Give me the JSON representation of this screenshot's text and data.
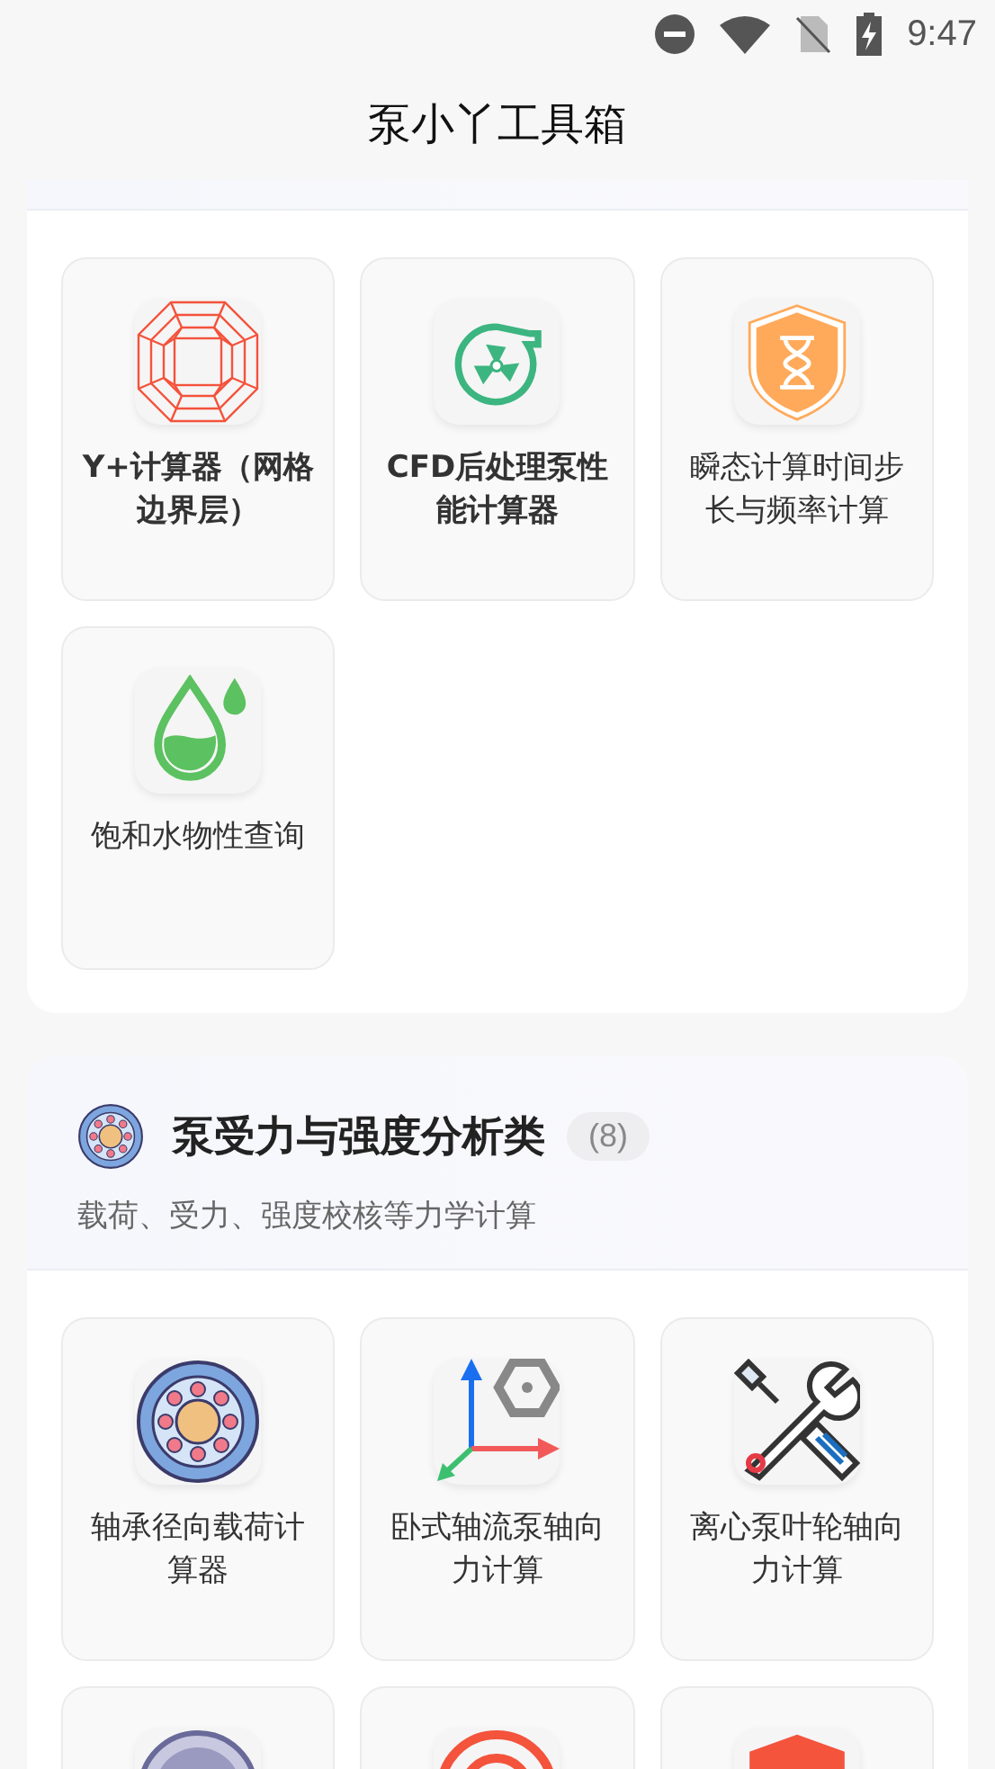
{
  "status_bar": {
    "time": "9:47"
  },
  "app_bar": {
    "title": "泵小丫工具箱"
  },
  "sections": [
    {
      "tools": [
        {
          "kind": "tool",
          "label": "Y+计算器（网格边界层）"
        },
        {
          "kind": "tool",
          "label": "CFD后处理泵性能计算器"
        },
        {
          "kind": "tool",
          "label": "瞬态计算时间步长与频率计算"
        },
        {
          "kind": "tool",
          "label": "饱和水物性查询"
        }
      ]
    },
    {
      "title": "泵受力与强度分析类",
      "count": "(8)",
      "subtitle": "载荷、受力、强度校核等力学计算",
      "tools": [
        {
          "kind": "tool",
          "label": "轴承径向载荷计算器"
        },
        {
          "kind": "tool",
          "label": "卧式轴流泵轴向力计算"
        },
        {
          "kind": "tool",
          "label": "离心泵叶轮轴向力计算"
        },
        {
          "kind": "cut"
        },
        {
          "kind": "cut"
        },
        {
          "kind": "cut"
        }
      ]
    }
  ]
}
